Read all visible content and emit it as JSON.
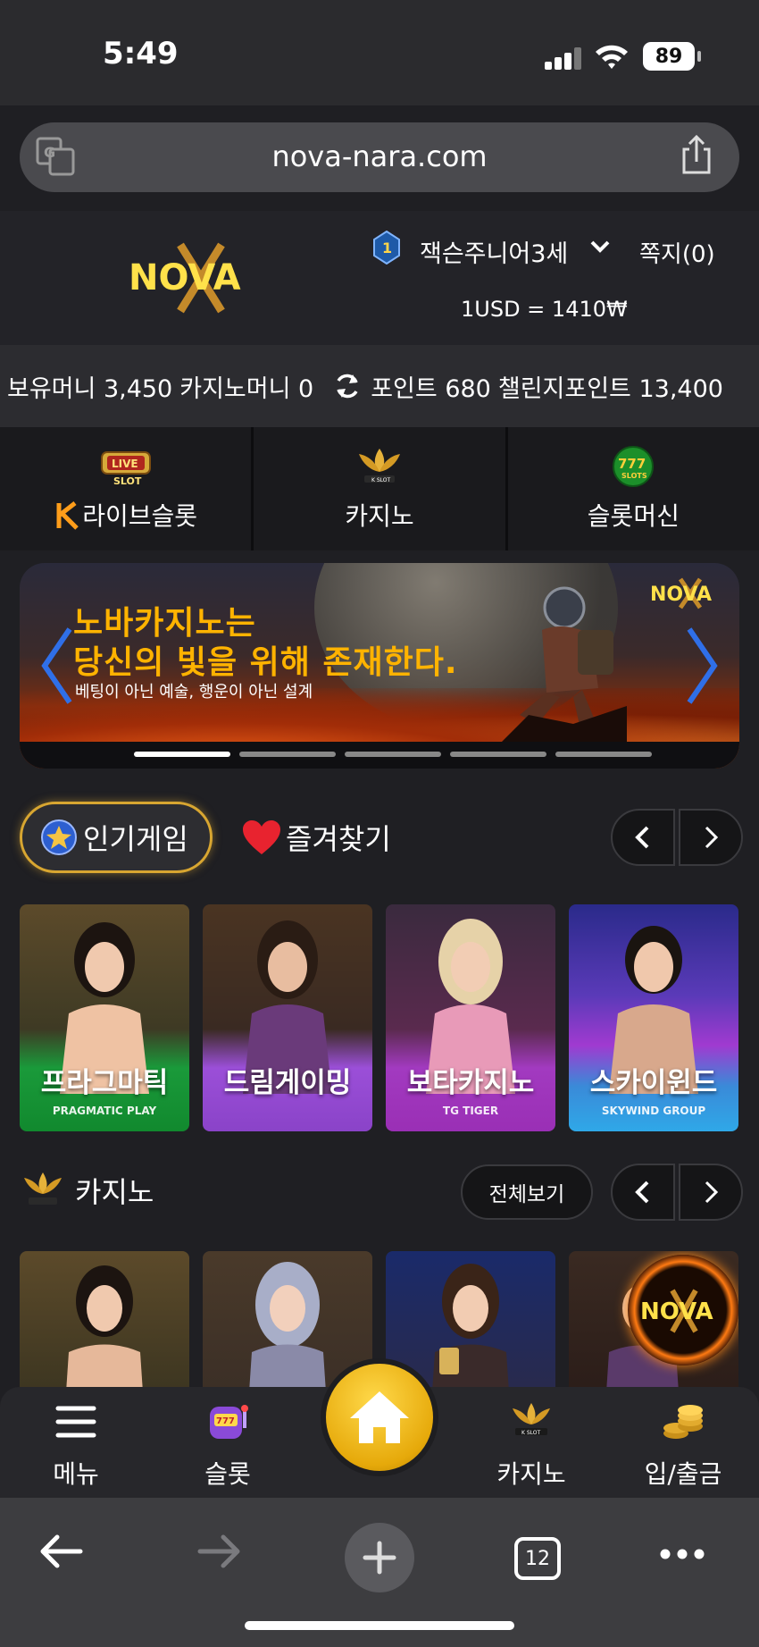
{
  "status": {
    "time": "5:49",
    "battery": "89"
  },
  "browser": {
    "url": "nova-nara.com",
    "tabs_count": "12"
  },
  "header": {
    "logo_text": "NOVA",
    "username": "잭슨주니어3세",
    "messages": "쪽지(0)",
    "rate": "1USD = 1410₩"
  },
  "balance": {
    "money": "보유머니 3,450",
    "casino_money": "카지노머니 0",
    "points": "포인트 680",
    "challenge_points": "챌린지포인트 13,400"
  },
  "categories": [
    {
      "label": "라이브슬롯"
    },
    {
      "label": "카지노"
    },
    {
      "label": "슬롯머신"
    }
  ],
  "banner": {
    "title1": "노바카지노는",
    "title2": "당신의 빛을 위해 존재한다.",
    "subtitle": "베팅이 아닌 예술, 행운이 아닌 설계",
    "slides": 5,
    "active_slide": 1
  },
  "section_tabs": {
    "popular": "인기게임",
    "favorites": "즐겨찾기"
  },
  "providers": [
    {
      "name": "프라그마틱",
      "brand": "PRAGMATIC PLAY"
    },
    {
      "name": "드림게이밍",
      "brand": ""
    },
    {
      "name": "보타카지노",
      "brand": "TG TIGER"
    },
    {
      "name": "스카이윈드",
      "brand": "SKYWIND GROUP"
    }
  ],
  "casino_section": {
    "title": "카지노",
    "view_all": "전체보기"
  },
  "bottom_nav": [
    {
      "label": "메뉴"
    },
    {
      "label": "슬롯"
    },
    {
      "label": "카지노"
    },
    {
      "label": "입/출금"
    }
  ]
}
